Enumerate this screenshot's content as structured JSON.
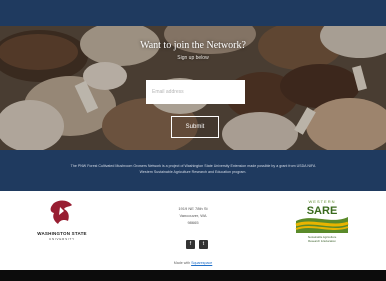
{
  "hero": {
    "title": "Want to join the Network?",
    "subtitle": "Sign up below",
    "email_placeholder": "Email address",
    "submit_label": "Submit"
  },
  "info": {
    "text": "The PNW Forest Cultivated Mushroom Growers Network is a project of Washington State University Extension made possible by a grant from USDA NIFA Western Sustainable Agriculture Research and Education program."
  },
  "footer": {
    "wsu_name": "WASHINGTON STATE",
    "wsu_sub": "UNIVERSITY",
    "address_line1": "1919 NE 78th St",
    "address_line2": "Vancouver, WA",
    "address_line3": "98665",
    "facebook_glyph": "f",
    "twitter_glyph": "t",
    "made_with_prefix": "Made with",
    "made_with_link": "Squarespace",
    "sare_top": "WESTERN",
    "sare_name": "SARE",
    "sare_caption_line1": "Sustainable Agriculture",
    "sare_caption_line2": "Research & Education"
  },
  "colors": {
    "navy": "#1f3a5f",
    "wsu_crimson": "#981e32",
    "sare_green": "#5a8a2a",
    "sare_gold": "#e8b400"
  },
  "icons": {
    "social": [
      "facebook-icon",
      "twitter-icon"
    ],
    "logos": [
      "wsu-cougar-logo",
      "sare-logo"
    ]
  }
}
